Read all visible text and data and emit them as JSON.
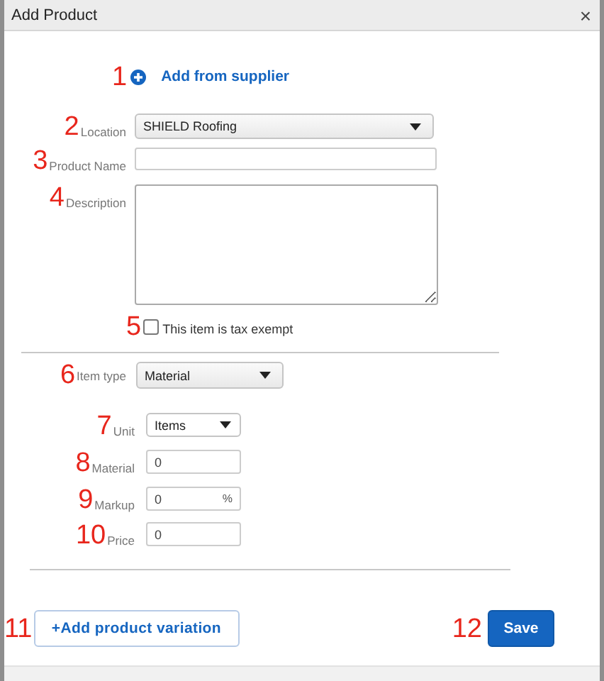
{
  "window": {
    "title": "Add Product",
    "close": "×"
  },
  "supplier_link": {
    "callout": "1",
    "label": "Add from supplier"
  },
  "fields": [
    {
      "kind": "select",
      "callout": "2",
      "label": "Location",
      "value": "SHIELD Roofing"
    },
    {
      "kind": "text",
      "callout": "3",
      "label": "Product Name"
    },
    {
      "kind": "textarea",
      "callout": "4",
      "label": "Description"
    }
  ],
  "tax_exempt": {
    "callout": "5",
    "label": "This item is tax exempt",
    "checked": false
  },
  "item_type": {
    "callout": "6",
    "label": "Item type",
    "value": "Material"
  },
  "pricing": [
    {
      "kind": "select",
      "callout": "7",
      "label": "Unit",
      "value": "Items"
    },
    {
      "kind": "number",
      "callout": "8",
      "label": "Material",
      "value": "0"
    },
    {
      "kind": "number",
      "callout": "9",
      "label": "Markup",
      "value": "0",
      "suffix": "%"
    },
    {
      "kind": "number",
      "callout": "10",
      "label": "Price",
      "value": "0"
    }
  ],
  "buttons": [
    {
      "kind": "secondary",
      "callout": "11",
      "label": "+Add product variation"
    },
    {
      "kind": "primary",
      "callout": "12",
      "label": "Save"
    }
  ]
}
